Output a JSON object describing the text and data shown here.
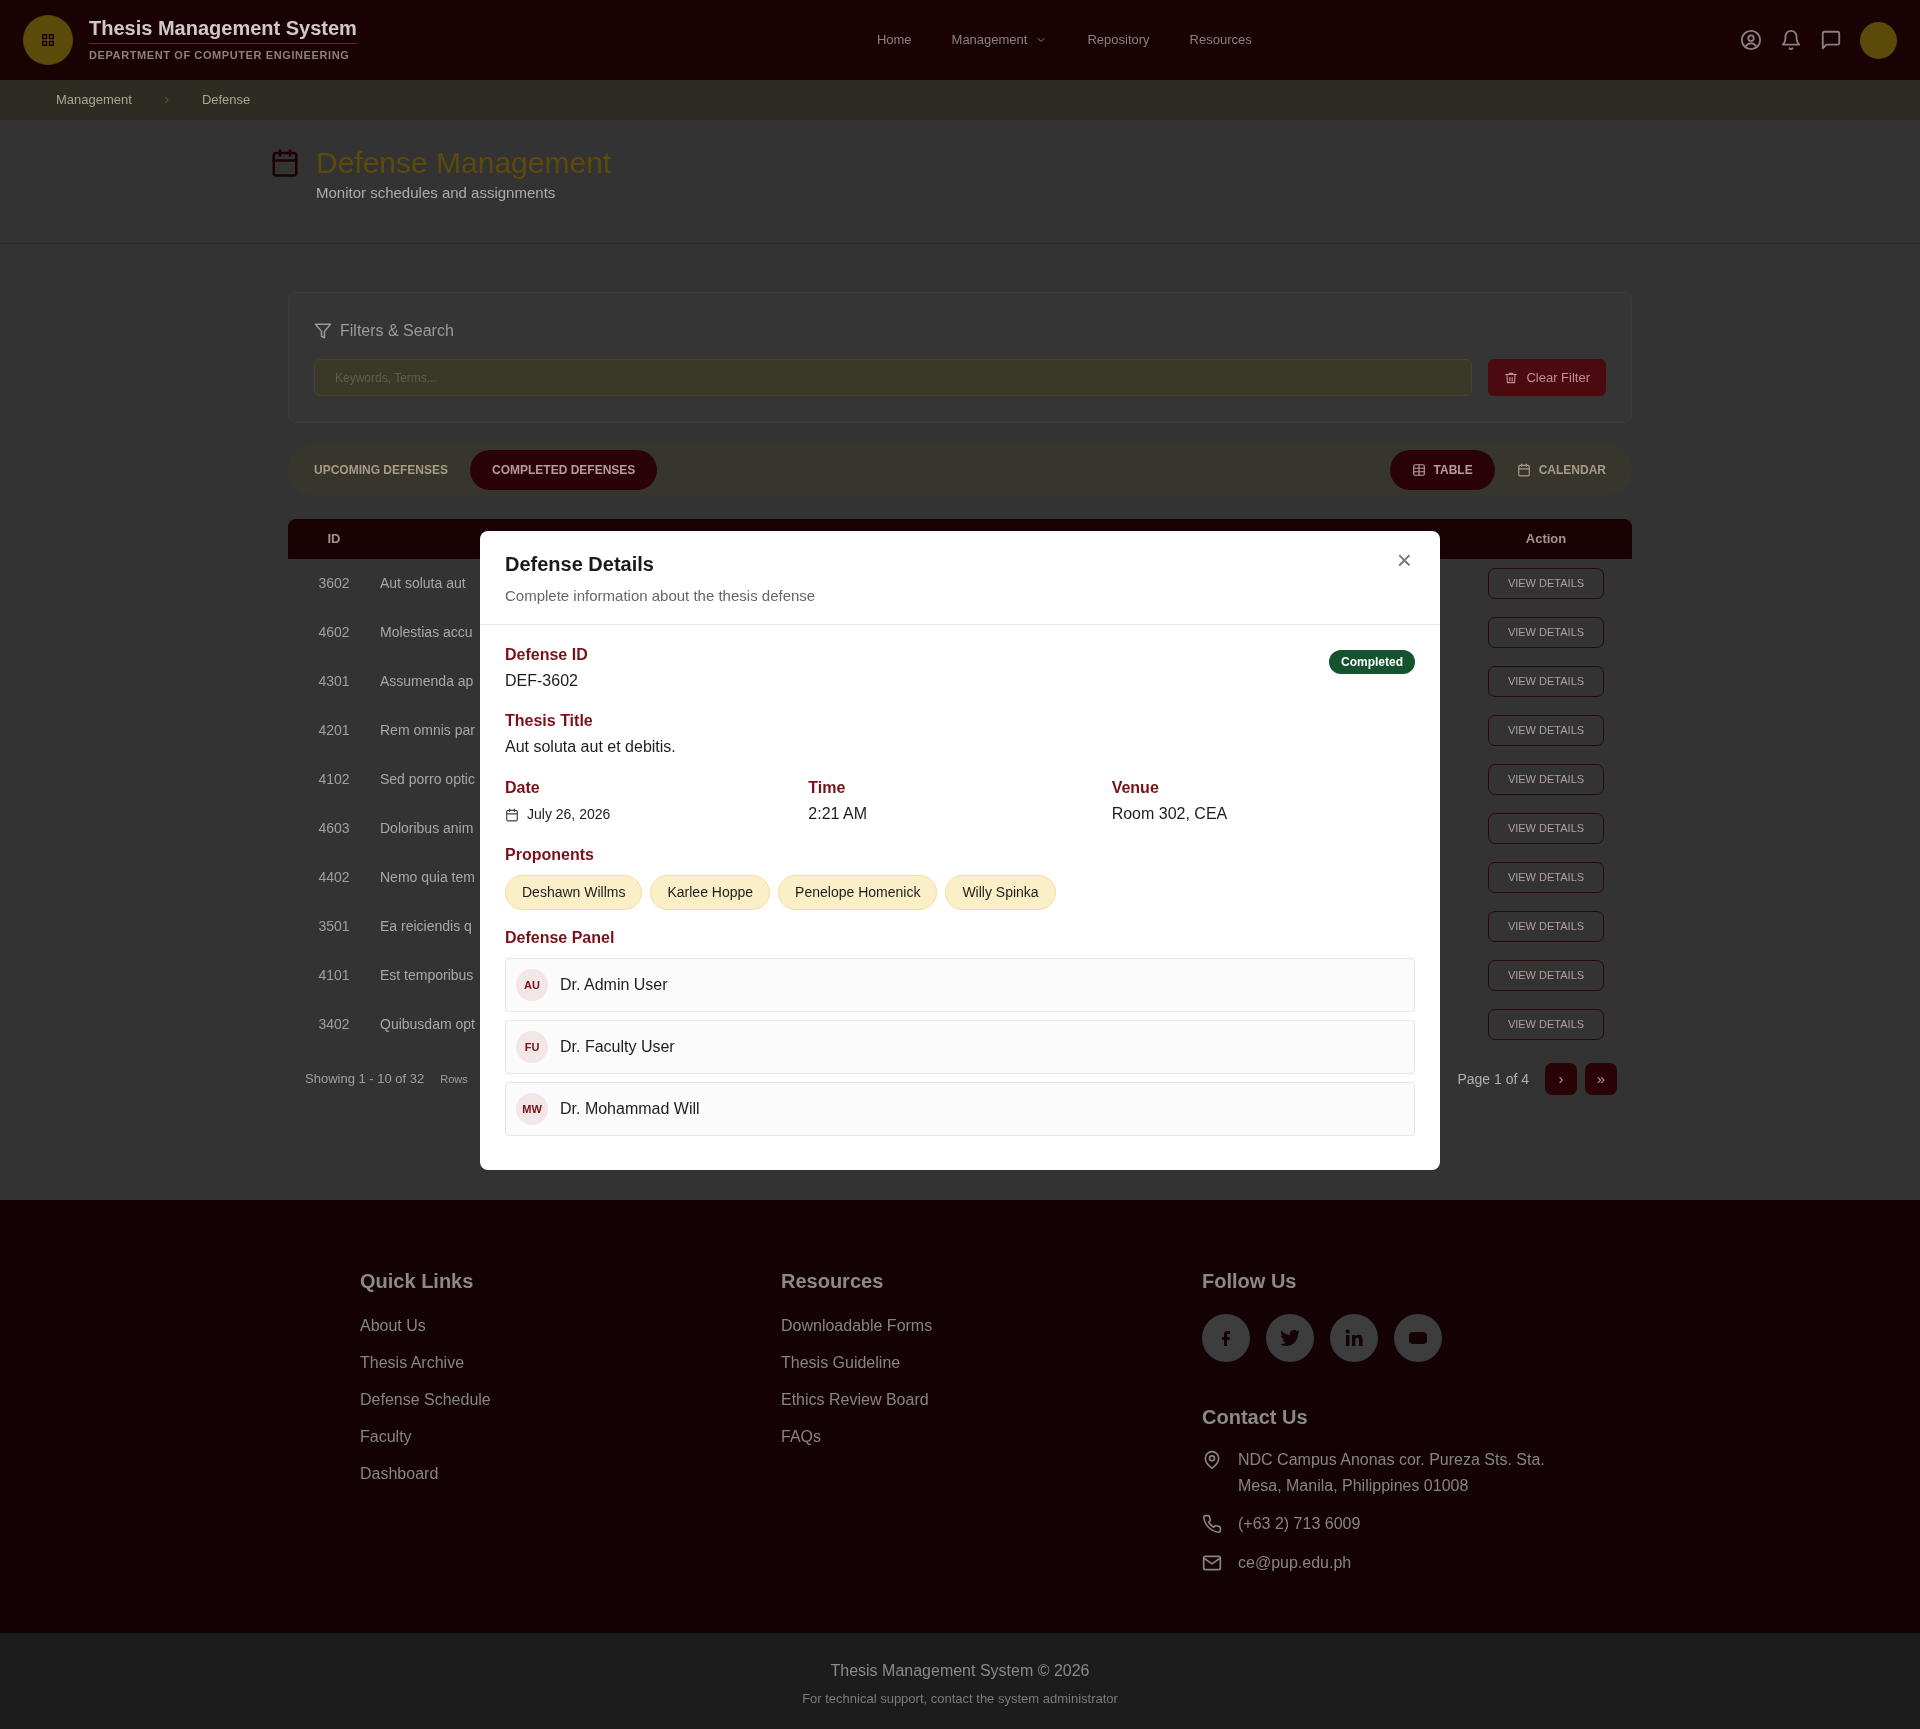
{
  "header": {
    "logo_title": "Thesis Management System",
    "logo_subtitle": "DEPARTMENT OF COMPUTER ENGINEERING",
    "nav": [
      {
        "label": "Home",
        "dropdown": false
      },
      {
        "label": "Management",
        "dropdown": true
      },
      {
        "label": "Repository",
        "dropdown": false
      },
      {
        "label": "Resources",
        "dropdown": false
      }
    ]
  },
  "breadcrumb": [
    "Management",
    "Defense"
  ],
  "page": {
    "title": "Defense Management",
    "subtitle": "Monitor schedules and assignments"
  },
  "filters": {
    "title": "Filters & Search",
    "search": {
      "placeholder": "Keywords, Terms..."
    },
    "clear_button": "Clear Filter"
  },
  "tabs": [
    {
      "label": "UPCOMING DEFENSES",
      "selected": false
    },
    {
      "label": "COMPLETED DEFENSES",
      "selected": true
    }
  ],
  "views": [
    {
      "label": "TABLE",
      "kind": "table",
      "selected": true
    },
    {
      "label": "CALENDAR",
      "kind": "calendar",
      "selected": false
    }
  ],
  "table": {
    "columns": [
      "ID",
      "Action"
    ],
    "rows": [
      {
        "id": "3602",
        "title": "Aut soluta aut",
        "action": "VIEW DETAILS"
      },
      {
        "id": "4602",
        "title": "Molestias accu",
        "action": "VIEW DETAILS"
      },
      {
        "id": "4301",
        "title": "Assumenda ap",
        "action": "VIEW DETAILS"
      },
      {
        "id": "4201",
        "title": "Rem omnis par",
        "action": "VIEW DETAILS"
      },
      {
        "id": "4102",
        "title": "Sed porro optic",
        "action": "VIEW DETAILS"
      },
      {
        "id": "4603",
        "title": "Doloribus anim",
        "action": "VIEW DETAILS"
      },
      {
        "id": "4402",
        "title": "Nemo quia tem",
        "action": "VIEW DETAILS"
      },
      {
        "id": "3501",
        "title": "Ea reiciendis q",
        "action": "VIEW DETAILS"
      },
      {
        "id": "4101",
        "title": "Est temporibus",
        "action": "VIEW DETAILS"
      },
      {
        "id": "3402",
        "title": "Quibusdam opt",
        "action": "VIEW DETAILS"
      }
    ]
  },
  "pagination": {
    "showing": "Showing 1 - 10 of 32",
    "rows_label": "Rows",
    "page": "Page 1 of 4",
    "next": "›",
    "last": "»"
  },
  "modal": {
    "title": "Defense Details",
    "subtitle": "Complete information about the thesis defense",
    "close": "×",
    "defense_id_label": "Defense ID",
    "defense_id": "DEF-3602",
    "status": "Completed",
    "thesis_title_label": "Thesis Title",
    "thesis_title": "Aut soluta aut et debitis.",
    "fields": [
      {
        "label": "Date",
        "value": "July 26, 2026",
        "kind": "date"
      },
      {
        "label": "Time",
        "value": "2:21 AM",
        "kind": "plain"
      },
      {
        "label": "Venue",
        "value": "Room 302, CEA",
        "kind": "plain"
      }
    ],
    "proponents_label": "Proponents",
    "proponents": [
      "Deshawn Willms",
      "Karlee Hoppe",
      "Penelope Homenick",
      "Willy Spinka"
    ],
    "panel_label": "Defense Panel",
    "panel": [
      {
        "initials": "AU",
        "name": "Dr. Admin User"
      },
      {
        "initials": "FU",
        "name": "Dr. Faculty User"
      },
      {
        "initials": "MW",
        "name": "Dr. Mohammad Will"
      }
    ]
  },
  "footer": {
    "quick_links": {
      "title": "Quick Links",
      "links": [
        "About Us",
        "Thesis Archive",
        "Defense Schedule",
        "Faculty",
        "Dashboard"
      ]
    },
    "resources": {
      "title": "Resources",
      "links": [
        "Downloadable Forms",
        "Thesis Guideline",
        "Ethics Review Board",
        "FAQs"
      ]
    },
    "follow_title": "Follow Us",
    "contact_title": "Contact Us",
    "contact": [
      {
        "kind": "address",
        "text": "NDC Campus Anonas cor. Pureza Sts. Sta. Mesa, Manila, Philippines 01008"
      },
      {
        "kind": "phone",
        "text": "(+63 2) 713 6009"
      },
      {
        "kind": "email",
        "text": "ce@pup.edu.ph"
      }
    ],
    "copyright": "Thesis Management System © 2026",
    "support": "For technical support, contact the system administrator"
  }
}
